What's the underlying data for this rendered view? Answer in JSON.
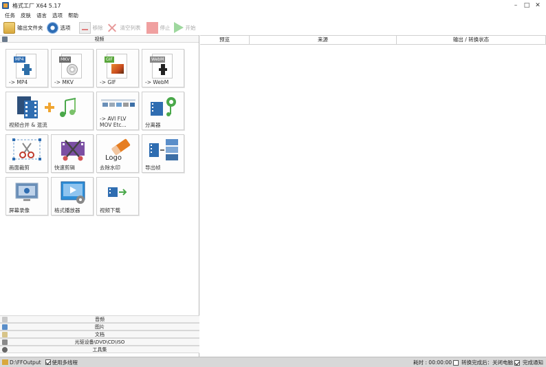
{
  "window": {
    "title": "格式工厂 X64 5.17",
    "controls": [
      "–",
      "□",
      "✕"
    ]
  },
  "menu": [
    "任务",
    "皮肤",
    "语言",
    "选项",
    "帮助"
  ],
  "toolbar": {
    "output_folder": "输出文件夹",
    "options": "选项",
    "remove": "移除",
    "clear_list": "清空列表",
    "stop": "停止",
    "start": "开始"
  },
  "left": {
    "video_header": "视频",
    "tiles": [
      {
        "label": "-> MP4",
        "badge": "MP4",
        "badge_color": "#2f6db1"
      },
      {
        "label": "-> MKV",
        "badge": "MKV",
        "badge_color": "#6b6b6b"
      },
      {
        "label": "-> GIF",
        "badge": "GIF",
        "badge_color": "#59a63b"
      },
      {
        "label": "-> WebM",
        "badge": "WebM",
        "badge_color": "#888888"
      },
      {
        "label": "视频合并 & 混流"
      },
      {
        "label": "-> AVI FLV\nMOV Etc..."
      },
      {
        "label": "分离器"
      },
      {
        "label": "画面裁剪"
      },
      {
        "label": "快速剪辑"
      },
      {
        "label": "去除水印"
      },
      {
        "label": "导出帧"
      },
      {
        "label": "屏幕录像"
      },
      {
        "label": "格式播放器"
      },
      {
        "label": "视频下载"
      }
    ],
    "categories": {
      "audio": "音频",
      "image": "图片",
      "document": "文档",
      "disc": "光驱设备\\DVD\\CD\\ISO",
      "tools": "工具集"
    }
  },
  "task_table": {
    "headers": [
      "预览",
      "来源",
      "输出 / 转换状态"
    ]
  },
  "status": {
    "output_path": "D:\\FFOutput",
    "multithread": "使用多线程",
    "elapsed": "耗时 : 00:00:00",
    "after_convert": "转换完成后：关闭电脑",
    "notify": "完成通知"
  }
}
